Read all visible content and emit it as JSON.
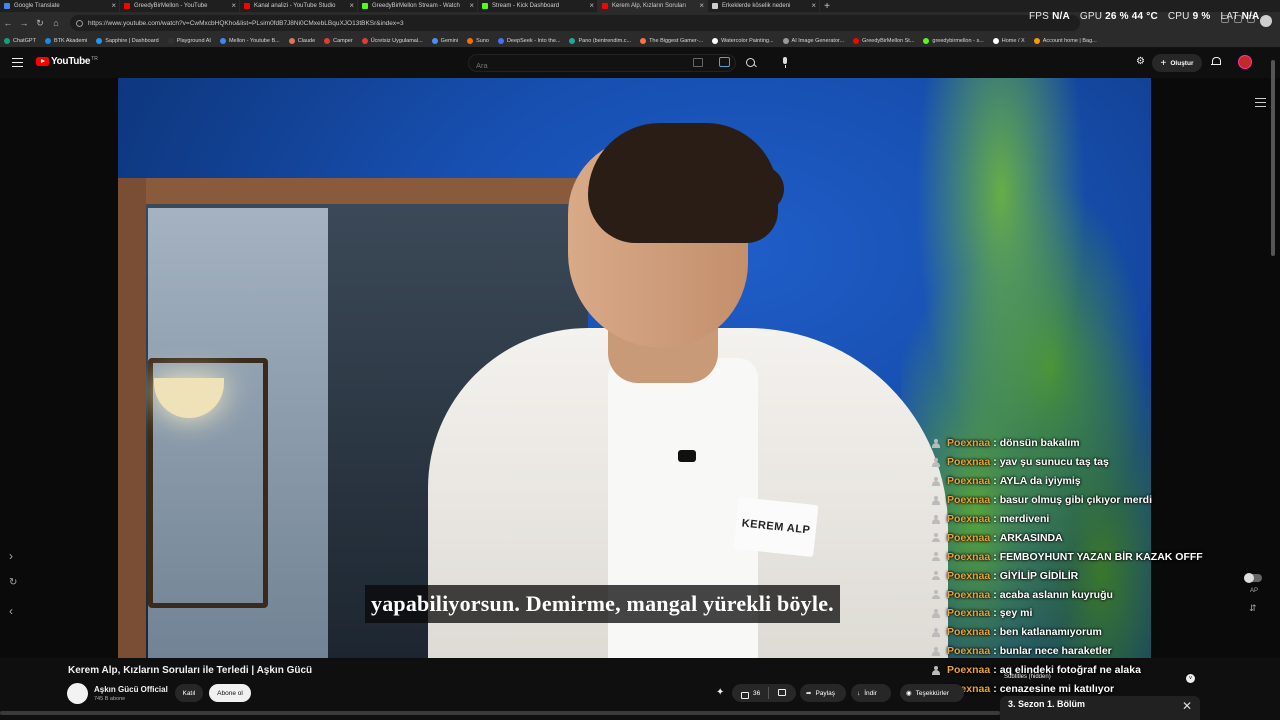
{
  "tabs": [
    {
      "label": "Google Translate",
      "color": "#4285f4"
    },
    {
      "label": "GreedyBirMellon - YouTube",
      "color": "#ff0000"
    },
    {
      "label": "Kanal analizi - YouTube Studio",
      "color": "#ff0000"
    },
    {
      "label": "GreedyBirMellon Stream - Watch",
      "color": "#53fc18"
    },
    {
      "label": "Stream - Kick Dashboard",
      "color": "#53fc18"
    },
    {
      "label": "Kerem Alp, Kızların Soruları",
      "color": "#ff0000"
    },
    {
      "label": "Erkeklerde köselik nedeni",
      "color": "#cccccc"
    }
  ],
  "stats": {
    "fps_label": "FPS",
    "fps_value": "N/A",
    "gpu_label": "GPU",
    "gpu_value": "26 % 44 °C",
    "cpu_label": "CPU",
    "cpu_value": "9 %",
    "lat_label": "LAT",
    "lat_value": "N/A"
  },
  "address": {
    "url": "https://www.youtube.com/watch?v=CwMxcbHQKho&list=PLsim0fdB7J8Ni0CMxebLBquXJO13tBKSr&index=3"
  },
  "bookmarks": [
    {
      "label": "ChatGPT",
      "color": "#10a37f"
    },
    {
      "label": "BTK Akademi",
      "color": "#1e88e5"
    },
    {
      "label": "Sapphire | Dashboard",
      "color": "#2196f3"
    },
    {
      "label": "Playground AI",
      "color": "#333333"
    },
    {
      "label": "Mellon - Youtube B...",
      "color": "#4285f4"
    },
    {
      "label": "Claude",
      "color": "#d97757"
    },
    {
      "label": "Camper",
      "color": "#e53935"
    },
    {
      "label": "Ücretsiz Uygulamal...",
      "color": "#e53935"
    },
    {
      "label": "Gemini",
      "color": "#4f8cf7"
    },
    {
      "label": "Suno",
      "color": "#ff6d00"
    },
    {
      "label": "DeepSeek - Into the...",
      "color": "#4d6bfe"
    },
    {
      "label": "Pano (bentrendim.c...",
      "color": "#26a69a"
    },
    {
      "label": "The Biggest Gamer-...",
      "color": "#ff7043"
    },
    {
      "label": "Watercolor Painting...",
      "color": "#ffffff"
    },
    {
      "label": "AI Image Generator...",
      "color": "#999999"
    },
    {
      "label": "GreedyBirMellon St...",
      "color": "#ff0000"
    },
    {
      "label": "greedybirmellon - s...",
      "color": "#53fc18"
    },
    {
      "label": "Home / X",
      "color": "#ffffff"
    },
    {
      "label": "Account home | Bag...",
      "color": "#ff9800"
    }
  ],
  "youtube": {
    "logo_text": "YouTube",
    "logo_cc": "TR",
    "search_placeholder": "Ara",
    "create_label": "Oluştur"
  },
  "video": {
    "nametag": "KEREM ALP",
    "subtitle": "yapabiliyorsun. Demirme, mangal yürekli böyle."
  },
  "chat": [
    {
      "user": "Poexnaa",
      "msg": "dönsün bakalım"
    },
    {
      "user": "Poexnaa",
      "msg": "yav şu sunucu taş taş"
    },
    {
      "user": "Poexnaa",
      "msg": "AYLA da iyiymiş"
    },
    {
      "user": "Poexnaa",
      "msg": "basur olmuş gibi çıkıyor merdi"
    },
    {
      "user": "Poexnaa",
      "msg": "merdiveni"
    },
    {
      "user": "Poexnaa",
      "msg": "ARKASINDA"
    },
    {
      "user": "Poexnaa",
      "msg": "FEMBOYHUNT YAZAN BİR KAZAK OFFF"
    },
    {
      "user": "Poexnaa",
      "msg": "GİYİLİP GİDİLİR"
    },
    {
      "user": "Poexnaa",
      "msg": "acaba aslanın kuyruğu"
    },
    {
      "user": "Poexnaa",
      "msg": "şey mi"
    },
    {
      "user": "Poexnaa",
      "msg": "ben katlanamıyorum"
    },
    {
      "user": "Poexnaa",
      "msg": "bunlar nece haraketler"
    },
    {
      "user": "Poexnaa",
      "msg": "aq elindeki fotoğraf ne alaka"
    },
    {
      "user": "Poexnaa",
      "msg": "cenazesine mi katılıyor"
    }
  ],
  "below": {
    "title": "Kerem Alp, Kızların Soruları ile Terledi | Aşkın Gücü",
    "channel": "Aşkın Gücü Official",
    "subs": "745 B abone",
    "join": "Katıl",
    "subscribe": "Abone ol",
    "likes": "36",
    "share": "Paylaş",
    "download": "İndir",
    "thanks": "Teşekkürler"
  },
  "side": {
    "ap_label": "AP"
  },
  "playlist": {
    "subtitles_hidden": "Subtitles (hidden)",
    "title": "3. Sezon 1. Bölüm"
  }
}
